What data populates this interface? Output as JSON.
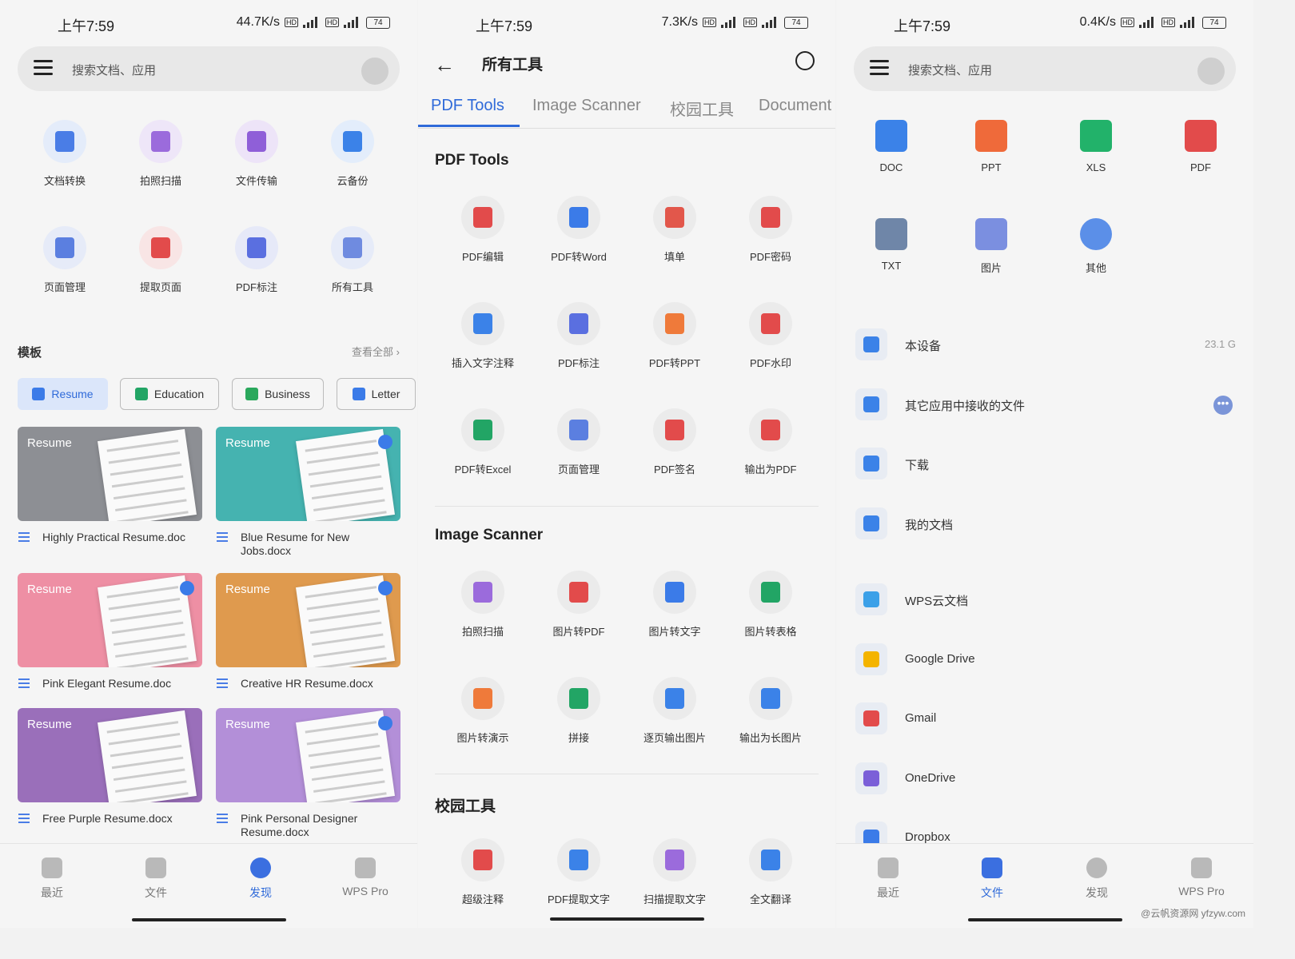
{
  "panel1": {
    "status": {
      "time": "上午7:59",
      "speed": "44.7K/s",
      "battery": "74"
    },
    "search": {
      "placeholder": "搜索文档、应用"
    },
    "tools": [
      {
        "label": "文档转换",
        "icon": "doc-convert-icon",
        "color": "#4a7de6",
        "bg": "#e4ecfa"
      },
      {
        "label": "拍照扫描",
        "icon": "scan-icon",
        "color": "#9b6bdc",
        "bg": "#eee6f8"
      },
      {
        "label": "文件传输",
        "icon": "transfer-icon",
        "color": "#8f5fd8",
        "bg": "#ede4f8"
      },
      {
        "label": "云备份",
        "icon": "cloud-icon",
        "color": "#3b82e8",
        "bg": "#e3edfb"
      },
      {
        "label": "页面管理",
        "icon": "page-manage-icon",
        "color": "#5b7fe0",
        "bg": "#e6ebf8"
      },
      {
        "label": "提取页面",
        "icon": "extract-page-icon",
        "color": "#e24b4b",
        "bg": "#f8e5e5"
      },
      {
        "label": "PDF标注",
        "icon": "pdf-annotate-icon",
        "color": "#5a6fe0",
        "bg": "#e6e9f8"
      },
      {
        "label": "所有工具",
        "icon": "more-icon",
        "color": "#6f8be0",
        "bg": "#e6ebf8"
      }
    ],
    "templates_title": "模板",
    "view_all": "查看全部",
    "chips": [
      {
        "label": "Resume",
        "color": "#3b7be8"
      },
      {
        "label": "Education",
        "color": "#22a565"
      },
      {
        "label": "Business",
        "color": "#2aa85c"
      },
      {
        "label": "Letter",
        "color": "#3b7be8"
      }
    ],
    "templates": [
      {
        "word": "Resume",
        "name": "Highly Practical Resume.doc",
        "bg": "#8d8f94"
      },
      {
        "word": "Resume",
        "name": "Blue Resume for New Jobs.docx",
        "bg": "#45b3b0"
      },
      {
        "word": "Resume",
        "name": "Pink Elegant Resume.doc",
        "bg": "#ee8fa4"
      },
      {
        "word": "Resume",
        "name": "Creative HR Resume.docx",
        "bg": "#df9a4e"
      },
      {
        "word": "Resume",
        "name": "Free Purple Resume.docx",
        "bg": "#9a6fba"
      },
      {
        "word": "Resume",
        "name": "Pink Personal Designer Resume.docx",
        "bg": "#b38fd8"
      }
    ],
    "nav": [
      "最近",
      "文件",
      "发现",
      "WPS Pro"
    ]
  },
  "panel2": {
    "status": {
      "time": "上午7:59",
      "speed": "7.3K/s",
      "battery": "74"
    },
    "title": "所有工具",
    "tabs": [
      "PDF Tools",
      "Image Scanner",
      "校园工具",
      "Document"
    ],
    "sections": [
      {
        "title": "PDF Tools",
        "items": [
          {
            "label": "PDF编辑",
            "color": "#e24b4b"
          },
          {
            "label": "PDF转Word",
            "color": "#3b7be8"
          },
          {
            "label": "填单",
            "color": "#e2574b"
          },
          {
            "label": "PDF密码",
            "color": "#e24b4b"
          },
          {
            "label": "插入文字注释",
            "color": "#3b82e8"
          },
          {
            "label": "PDF标注",
            "color": "#5a6fe0"
          },
          {
            "label": "PDF转PPT",
            "color": "#ef7a3a"
          },
          {
            "label": "PDF水印",
            "color": "#e24b4b"
          },
          {
            "label": "PDF转Excel",
            "color": "#22a565"
          },
          {
            "label": "页面管理",
            "color": "#5b7fe0"
          },
          {
            "label": "PDF签名",
            "color": "#e24b4b"
          },
          {
            "label": "输出为PDF",
            "color": "#e24b4b"
          }
        ]
      },
      {
        "title": "Image Scanner",
        "items": [
          {
            "label": "拍照扫描",
            "color": "#9b6bdc"
          },
          {
            "label": "图片转PDF",
            "color": "#e24b4b"
          },
          {
            "label": "图片转文字",
            "color": "#3b7be8"
          },
          {
            "label": "图片转表格",
            "color": "#22a565"
          },
          {
            "label": "图片转演示",
            "color": "#ef7a3a"
          },
          {
            "label": "拼接",
            "color": "#22a565"
          },
          {
            "label": "逐页输出图片",
            "color": "#3b82e8"
          },
          {
            "label": "输出为长图片",
            "color": "#3b82e8"
          }
        ]
      },
      {
        "title": "校园工具",
        "items": [
          {
            "label": "超级注释",
            "color": "#e24b4b"
          },
          {
            "label": "PDF提取文字",
            "color": "#3b82e8"
          },
          {
            "label": "扫描提取文字",
            "color": "#9b6bdc"
          },
          {
            "label": "全文翻译",
            "color": "#3b82e8"
          }
        ]
      }
    ]
  },
  "panel3": {
    "status": {
      "time": "上午7:59",
      "speed": "0.4K/s",
      "battery": "74"
    },
    "search": {
      "placeholder": "搜索文档、应用"
    },
    "filetypes": [
      {
        "label": "DOC",
        "color": "#3b82e8"
      },
      {
        "label": "PPT",
        "color": "#ef6a3a"
      },
      {
        "label": "XLS",
        "color": "#22b26a"
      },
      {
        "label": "PDF",
        "color": "#e24b4b"
      },
      {
        "label": "TXT",
        "color": "#6f86a8"
      },
      {
        "label": "图片",
        "color": "#7b8fe0"
      },
      {
        "label": "其他",
        "color": "#5b8fe8"
      }
    ],
    "locations": [
      {
        "label": "本设备",
        "right": "23.1 G",
        "color": "#3b82e8"
      },
      {
        "label": "其它应用中接收的文件",
        "right": "",
        "color": "#3b82e8"
      },
      {
        "label": "下载",
        "right": "",
        "color": "#3b82e8"
      },
      {
        "label": "我的文档",
        "right": "",
        "color": "#3b82e8"
      },
      {
        "label": "WPS云文档",
        "right": "",
        "color": "#3ba0e8"
      },
      {
        "label": "Google Drive",
        "right": "",
        "color": "#f4b400"
      },
      {
        "label": "Gmail",
        "right": "",
        "color": "#e24b4b"
      },
      {
        "label": "OneDrive",
        "right": "",
        "color": "#7b5fd8"
      },
      {
        "label": "Dropbox",
        "right": "",
        "color": "#3b7be8"
      }
    ],
    "more_dots": "•••",
    "nav": [
      "最近",
      "文件",
      "发现",
      "WPS Pro"
    ],
    "watermark": "@云帆资源网 yfzyw.com"
  }
}
